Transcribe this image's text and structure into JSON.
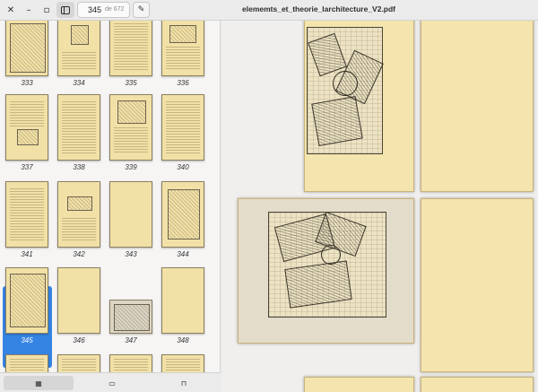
{
  "window": {
    "close_icon": "✕",
    "minimize_icon": "–",
    "maximize_icon": "▫",
    "title": "elememts_et_theorie_larchitecture_V2.pdf"
  },
  "toolbar": {
    "current_page": "345",
    "page_total": "de 672",
    "sidebar_icon": "sidebar-toggle-icon",
    "annotate_icon": "✎"
  },
  "sidebar": {
    "thumbnails": [
      {
        "label": "333"
      },
      {
        "label": "334"
      },
      {
        "label": "335"
      },
      {
        "label": "336"
      },
      {
        "label": "337"
      },
      {
        "label": "338"
      },
      {
        "label": "339"
      },
      {
        "label": "340"
      },
      {
        "label": "341"
      },
      {
        "label": "342"
      },
      {
        "label": "343"
      },
      {
        "label": "344"
      },
      {
        "label": "345"
      },
      {
        "label": "346"
      },
      {
        "label": "347"
      },
      {
        "label": "348"
      }
    ],
    "selected_page": "345",
    "footer": {
      "thumbnails_icon": "▦",
      "annotations_icon": "▭",
      "bookmarks_icon": "⊓"
    }
  },
  "colors": {
    "accent": "#3584e4",
    "paper": "#f4e5ae",
    "sidebar_bg": "#f6f5f4",
    "main_bg": "#f0efed"
  }
}
